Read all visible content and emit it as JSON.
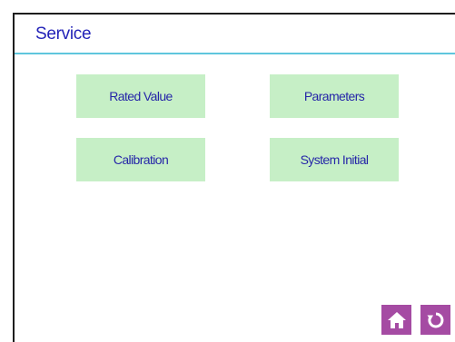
{
  "header": {
    "title": "Service"
  },
  "menu": {
    "rated_value": "Rated Value",
    "parameters": "Parameters",
    "calibration": "Calibration",
    "system_initial": "System Initial"
  },
  "footer": {
    "home_icon": "home-icon",
    "back_icon": "refresh-icon"
  },
  "colors": {
    "title_text": "#2323b8",
    "accent_line": "#5fc6dd",
    "button_bg": "#c6efc6",
    "button_text": "#2626a8",
    "nav_button_bg": "#a54ba3"
  }
}
